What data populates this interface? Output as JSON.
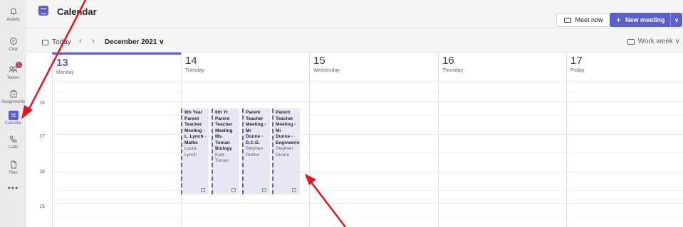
{
  "rail": {
    "items": [
      {
        "label": "Activity",
        "icon": "bell-icon"
      },
      {
        "label": "Chat",
        "icon": "chat-icon"
      },
      {
        "label": "Teams",
        "icon": "teams-icon",
        "badge": "1"
      },
      {
        "label": "Assignments",
        "icon": "assignments-icon"
      },
      {
        "label": "Calendar",
        "icon": "calendar-icon"
      },
      {
        "label": "Calls",
        "icon": "phone-icon"
      },
      {
        "label": "Files",
        "icon": "file-icon"
      }
    ],
    "more": "•••"
  },
  "header": {
    "title": "Calendar",
    "meet_now": "Meet now",
    "new_meeting": "New meeting",
    "new_meeting_plus": "+",
    "new_meeting_caret": "∨"
  },
  "nav": {
    "today": "Today",
    "prev": "‹",
    "next": "›",
    "month": "December 2021 ∨",
    "view": "Work week ∨"
  },
  "days": [
    {
      "num": "13",
      "name": "Monday"
    },
    {
      "num": "14",
      "name": "Tuesday"
    },
    {
      "num": "15",
      "name": "Wednesday"
    },
    {
      "num": "16",
      "name": "Thursday"
    },
    {
      "num": "17",
      "name": "Friday"
    }
  ],
  "hours": [
    "16",
    "17",
    "18",
    "19"
  ],
  "events": [
    {
      "title": "6th Year\nParent\nTeacher\nMeeting -\nL. Lynch -\nMaths",
      "organizer": "Laura\nLynch"
    },
    {
      "title": "6th Yr\nParent\nTeacher\nMeeting\nMs.\nToman\nBiology",
      "organizer": "Kate\nToman"
    },
    {
      "title": "Parent\nTeacher\nMeeting -\nMr\nDunne -\nD.C.G.",
      "organizer": "Stephen\nDunne"
    },
    {
      "title": "Parent\nTeacher\nMeeting -\nMr\nDunne -\nEngineerin",
      "organizer": "Stephen\nDunne"
    }
  ],
  "colors": {
    "accent": "#5b5fc7",
    "annotation_arrow": "#e8141b",
    "event_bg": "#e8e8f5"
  }
}
